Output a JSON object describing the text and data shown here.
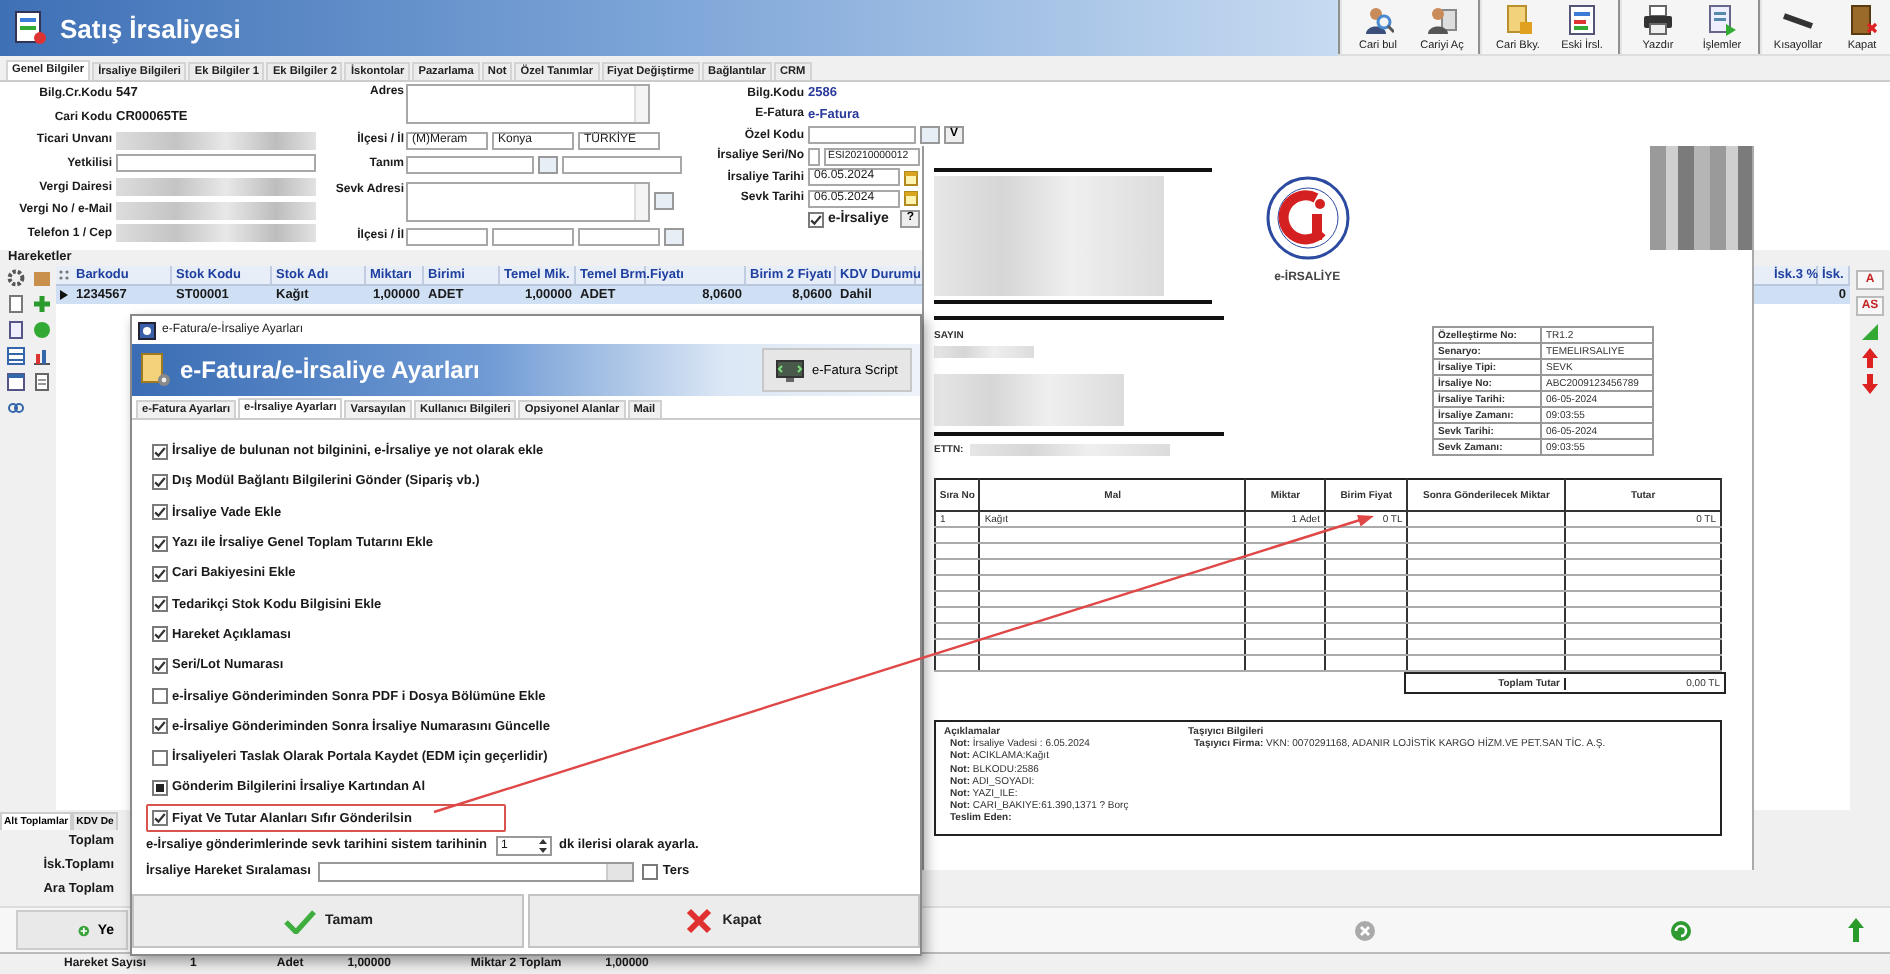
{
  "window": {
    "title": "Satış İrsaliyesi"
  },
  "toolbar_groups": [
    {
      "buttons": [
        {
          "label": "Cari bul"
        },
        {
          "label": "Cariyi Aç"
        }
      ]
    },
    {
      "buttons": [
        {
          "label": "Cari Bky."
        },
        {
          "label": "Eski İrsl."
        }
      ]
    },
    {
      "buttons": [
        {
          "label": "Yazdır"
        },
        {
          "label": "İşlemler"
        }
      ]
    },
    {
      "buttons": [
        {
          "label": "Kısayollar"
        },
        {
          "label": "Kapat"
        }
      ]
    }
  ],
  "tabs": [
    {
      "label": "Genel Bilgiler",
      "selected": true
    },
    {
      "label": "İrsaliye Bilgileri",
      "selected": false
    },
    {
      "label": "Ek Bilgiler 1",
      "selected": false
    },
    {
      "label": "Ek Bilgiler 2",
      "selected": false
    },
    {
      "label": "İskontolar",
      "selected": false
    },
    {
      "label": "Pazarlama",
      "selected": false
    },
    {
      "label": "Not",
      "selected": false
    },
    {
      "label": "Özel Tanımlar",
      "selected": false
    },
    {
      "label": "Fiyat Değiştirme",
      "selected": false
    },
    {
      "label": "Bağlantılar",
      "selected": false
    },
    {
      "label": "CRM",
      "selected": false
    }
  ],
  "customer": [
    {
      "label": "Bilg.Cr.Kodu",
      "value": "547",
      "kind": "text"
    },
    {
      "label": "Cari Kodu",
      "value": "CR00065TE",
      "kind": "text"
    },
    {
      "label": "Ticari Unvanı",
      "kind": "redacted"
    },
    {
      "label": "Yetkilisi",
      "kind": "field"
    },
    {
      "label": "Vergi Dairesi",
      "kind": "redacted"
    },
    {
      "label": "Vergi No / e-Mail",
      "kind": "redacted"
    },
    {
      "label": "Telefon 1 / Cep",
      "kind": "redacted"
    }
  ],
  "address": {
    "address_label": "Adres",
    "district_label": "İlçesi / İl",
    "district_values": [
      "(M)Meram",
      "Konya",
      "TÜRKİYE"
    ],
    "definition_label": "Tanım",
    "shipping_label": "Sevk Adresi",
    "shipping_district_label": "İlçesi / İl"
  },
  "document": {
    "bilg_code_label": "Bilg.Kodu",
    "bilg_code": "2586",
    "efatura_label": "E-Fatura",
    "efatura": "e-Fatura",
    "special_code_label": "Özel Kodu",
    "special_code_button": "V",
    "series_label": "İrsaliye Seri/No",
    "series_no": "ESI20210000012",
    "date_label": "İrsaliye Tarihi",
    "date": "06.05.2024",
    "ship_date_label": "Sevk Tarihi",
    "ship_date": "06.05.2024",
    "e_irsaliye": {
      "label": "e-İrsaliye",
      "checked": true
    },
    "help_button": "?"
  },
  "movements": {
    "title": "Hareketler",
    "columns": [
      "Barkodu",
      "Stok Kodu",
      "Stok Adı",
      "Miktarı",
      "Birimi",
      "Temel Mik.",
      "Temel Brm.",
      "Fiyatı",
      "Birim 2 Fiyatı",
      "KDV Durumu"
    ],
    "rows": [
      {
        "selected": true,
        "cells": [
          "1234567",
          "ST00001",
          "Kağıt",
          "1,00000",
          "ADET",
          "1,00000",
          "ADET",
          "8,0600",
          "8,0600",
          "Dahil"
        ]
      }
    ],
    "right_columns": [
      "İsk.3 %",
      "İsk."
    ],
    "right_rows": [
      {
        "cells": [
          "0"
        ]
      }
    ]
  },
  "side_tools": [
    "A",
    "AS"
  ],
  "totals": {
    "tabs": [
      {
        "label": "Alt Toplamlar",
        "selected": true
      },
      {
        "label": "KDV De",
        "selected": false
      }
    ],
    "labels": [
      "Toplam",
      "İsk.Toplamı",
      "Ara Toplam"
    ]
  },
  "bottom_button": "Ye",
  "status_bar": [
    {
      "label": "Hareket Sayısı",
      "value": "1"
    },
    {
      "label": "Adet",
      "value": "1,00000"
    },
    {
      "label": "Miktar 2 Toplam",
      "value": "1,00000"
    }
  ],
  "dialog": {
    "window_title": "e-Fatura/e-İrsaliye Ayarları",
    "heading": "e-Fatura/e-İrsaliye Ayarları",
    "script_button": "e-Fatura Script",
    "tabs": [
      {
        "label": "e-Fatura Ayarları",
        "selected": false
      },
      {
        "label": "e-İrsaliye Ayarları",
        "selected": true
      },
      {
        "label": "Varsayılan",
        "selected": false
      },
      {
        "label": "Kullanıcı Bilgileri",
        "selected": false
      },
      {
        "label": "Opsiyonel Alanlar",
        "selected": false
      },
      {
        "label": "Mail",
        "selected": false
      }
    ],
    "options": [
      {
        "label": "İrsaliye de bulunan not bilginini, e-İrsaliye ye not olarak ekle",
        "kind": "check",
        "checked": true,
        "highlighted": false
      },
      {
        "label": "Dış Modül Bağlantı Bilgilerini Gönder (Sipariş vb.)",
        "kind": "check",
        "checked": true,
        "highlighted": false
      },
      {
        "label": "İrsaliye Vade Ekle",
        "kind": "check",
        "checked": true,
        "highlighted": false
      },
      {
        "label": "Yazı ile İrsaliye Genel Toplam Tutarını Ekle",
        "kind": "check",
        "checked": true,
        "highlighted": false
      },
      {
        "label": "Cari Bakiyesini Ekle",
        "kind": "check",
        "checked": true,
        "highlighted": false
      },
      {
        "label": "Tedarikçi Stok Kodu Bilgisini Ekle",
        "kind": "check",
        "checked": true,
        "highlighted": false
      },
      {
        "label": "Hareket Açıklaması",
        "kind": "check",
        "checked": true,
        "highlighted": false
      },
      {
        "label": "Seri/Lot Numarası",
        "kind": "check",
        "checked": true,
        "highlighted": false
      },
      {
        "label": "e-İrsaliye Gönderiminden Sonra PDF i Dosya Bölümüne Ekle",
        "kind": "check",
        "checked": false,
        "highlighted": false
      },
      {
        "label": "e-İrsaliye Gönderiminden Sonra İrsaliye Numarasını Güncelle",
        "kind": "check",
        "checked": true,
        "highlighted": false
      },
      {
        "label": "İrsaliyeleri Taslak Olarak Portala Kaydet (EDM için geçerlidir)",
        "kind": "check",
        "checked": false,
        "highlighted": false
      },
      {
        "label": "Gönderim Bilgilerini İrsaliye Kartından Al",
        "kind": "filled",
        "checked": true,
        "highlighted": false
      },
      {
        "label": "Fiyat Ve Tutar Alanları Sıfır Gönderilsin",
        "kind": "check",
        "checked": true,
        "highlighted": true
      }
    ],
    "offset": {
      "prefix": "e-İrsaliye gönderimlerinde sevk tarihini sistem tarihinin",
      "value": "1",
      "suffix": "dk ilerisi olarak ayarla."
    },
    "sort": {
      "label": "İrsaliye Hareket Sıralaması",
      "reverse": {
        "label": "Ters",
        "checked": false
      }
    },
    "buttons": [
      {
        "label": "Tamam",
        "kind": "ok"
      },
      {
        "label": "Kapat",
        "kind": "close"
      }
    ]
  },
  "invoice": {
    "title": "e-İRSALİYE",
    "recipient_label": "SAYIN",
    "ettn_label": "ETTN:",
    "info": [
      {
        "label": "Özelleştirme No:",
        "value": "TR1.2"
      },
      {
        "label": "Senaryo:",
        "value": "TEMELIRSALIYE"
      },
      {
        "label": "İrsaliye Tipi:",
        "value": "SEVK"
      },
      {
        "label": "İrsaliye No:",
        "value": "ABC2009123456789"
      },
      {
        "label": "İrsaliye Tarihi:",
        "value": "06-05-2024"
      },
      {
        "label": "İrsaliye Zamanı:",
        "value": "09:03:55"
      },
      {
        "label": "Sevk Tarihi:",
        "value": "06-05-2024"
      },
      {
        "label": "Sevk Zamanı:",
        "value": "09:03:55"
      }
    ],
    "columns": [
      "Sıra No",
      "Mal",
      "Miktar",
      "Birim Fiyat",
      "Sonra Gönderilecek Miktar",
      "Tutar"
    ],
    "rows": [
      {
        "no": "1",
        "item": "Kağıt",
        "quantity": "1 Adet",
        "unit_price": "0 TL",
        "total": "0 TL"
      }
    ],
    "total_label": "Toplam Tutar",
    "total": "0,00 TL",
    "notes_title": "Açıklamalar",
    "notes": [
      "**Not:** İrsaliye Vadesi : 6.05.2024",
      "**Not:** ACIKLAMA:Kağıt",
      "**Not:** BLKODU:2586",
      "**Not:** ADI_SOYADI:",
      "**Not:** YAZI_ILE:",
      "**Not:** CARI_BAKIYE:61.390,1371 ? Borç"
    ],
    "delivered_by_label": "Teslim Eden:",
    "carrier_title": "Taşıyıcı Bilgileri",
    "carrier": "**Taşıyıcı Firma:** VKN: 0070291168, ADANIR LOJİSTİK KARGO HİZM.VE PET.SAN TİC. A.Ş."
  }
}
